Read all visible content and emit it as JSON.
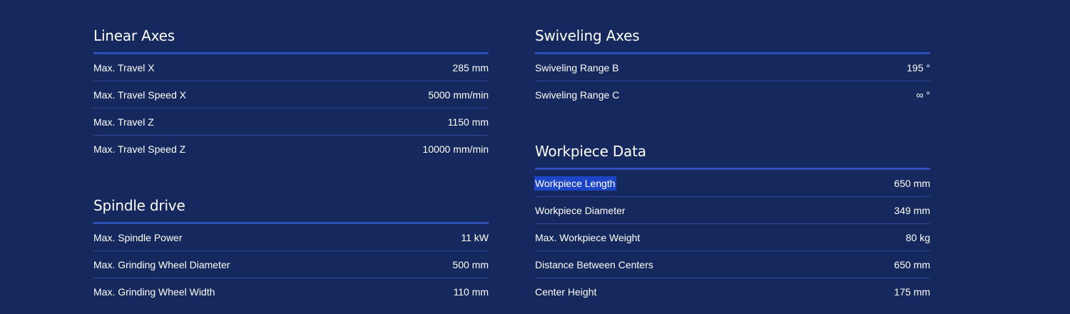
{
  "left": {
    "linear_axes": {
      "title": "Linear Axes",
      "rows": [
        {
          "label": "Max. Travel X",
          "value": "285 mm"
        },
        {
          "label": "Max. Travel Speed X",
          "value": "5000 mm/min"
        },
        {
          "label": "Max. Travel Z",
          "value": "1150 mm"
        },
        {
          "label": "Max. Travel Speed Z",
          "value": "10000 mm/min"
        }
      ]
    },
    "spindle_drive": {
      "title": "Spindle drive",
      "rows": [
        {
          "label": "Max. Spindle Power",
          "value": "11 kW"
        },
        {
          "label": "Max. Grinding Wheel Diameter",
          "value": "500 mm"
        },
        {
          "label": "Max. Grinding Wheel Width",
          "value": "110 mm"
        }
      ]
    }
  },
  "right": {
    "swiveling_axes": {
      "title": "Swiveling Axes",
      "rows": [
        {
          "label": "Swiveling Range B",
          "value": "195 °"
        },
        {
          "label": "Swiveling Range C",
          "value": "∞ °"
        }
      ]
    },
    "workpiece_data": {
      "title": "Workpiece Data",
      "rows": [
        {
          "label": "Workpiece Length",
          "value": "650 mm"
        },
        {
          "label": "Workpiece Diameter",
          "value": "349 mm"
        },
        {
          "label": "Max. Workpiece Weight",
          "value": "80 kg"
        },
        {
          "label": "Distance Between Centers",
          "value": "650 mm"
        },
        {
          "label": "Center Height",
          "value": "175 mm"
        }
      ]
    }
  },
  "colors": {
    "background": "#16295e",
    "accent_rule": "#2e4fb6",
    "row_divider": "#2d4a9a",
    "selection_highlight": "#1d46c6",
    "text": "#ffffff"
  }
}
